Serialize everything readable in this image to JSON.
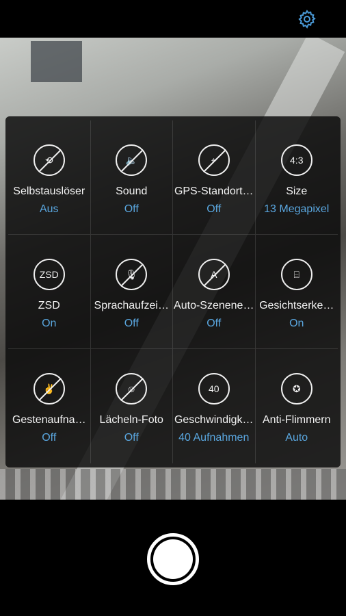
{
  "accent_color": "#5aa7e0",
  "settings_icon": "gear-icon",
  "settings": [
    {
      "label": "Selbstauslöser",
      "value": "Aus",
      "icon": "timer-off-icon",
      "glyph": "⟲"
    },
    {
      "label": "Sound",
      "value": "Off",
      "icon": "sound-off-icon",
      "glyph": "🔈"
    },
    {
      "label": "GPS-Standort…",
      "value": "Off",
      "icon": "location-off-icon",
      "glyph": "⌖"
    },
    {
      "label": "Size",
      "value": "13 Megapixel",
      "icon": "aspect-ratio-icon",
      "glyph": "4:3"
    },
    {
      "label": "ZSD",
      "value": "On",
      "icon": "zsd-icon",
      "glyph": "ZSD"
    },
    {
      "label": "Sprachaufzei…",
      "value": "Off",
      "icon": "voice-off-icon",
      "glyph": "🎙"
    },
    {
      "label": "Auto-Szenene…",
      "value": "Off",
      "icon": "auto-scene-off-icon",
      "glyph": "A"
    },
    {
      "label": "Gesichtserke…",
      "value": "On",
      "icon": "face-detect-icon",
      "glyph": "⌸"
    },
    {
      "label": "Gestenaufna…",
      "value": "Off",
      "icon": "gesture-off-icon",
      "glyph": "✌"
    },
    {
      "label": "Lächeln-Foto",
      "value": "Off",
      "icon": "smile-off-icon",
      "glyph": "☺"
    },
    {
      "label": "Geschwindigk…",
      "value": "40 Aufnahmen",
      "icon": "burst-icon",
      "glyph": "40"
    },
    {
      "label": "Anti-Flimmern",
      "value": "Auto",
      "icon": "anti-flicker-icon",
      "glyph": "✪"
    }
  ]
}
